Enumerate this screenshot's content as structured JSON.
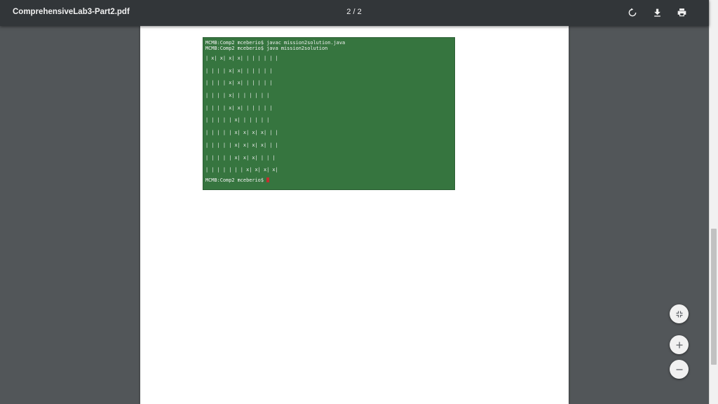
{
  "toolbar": {
    "title": "ComprehensiveLab3-Part2.pdf",
    "page_indicator": "2 / 2",
    "rotate_icon": "rotate-icon",
    "download_icon": "download-icon",
    "print_icon": "print-icon"
  },
  "terminal": {
    "lines": [
      "MCMB:Comp2 mceberio$ javac mission2solution.java",
      "MCMB:Comp2 mceberio$ java mission2solution"
    ],
    "grid_rows": [
      "| x| x| x| x| | | | | | |",
      "| | | | x| x| | | | | |",
      "| | | | x| x| | | | | |",
      "| | | | x| | | | | | |",
      "| | | | x| x| | | | | |",
      "| | | | | x| | | | | |",
      "| | | | | x| x| x| x| | |",
      "| | | | | x| x| x| x| | |",
      "| | | | | x| x| x| | | |",
      "| | | | | | | x| x| x| x|"
    ],
    "prompt": "MCMB:Comp2 mceberio$ "
  },
  "zoom_controls": {
    "fit_icon": "fit-to-page-icon",
    "zoom_in_icon": "zoom-in-icon",
    "zoom_out_icon": "zoom-out-icon"
  }
}
